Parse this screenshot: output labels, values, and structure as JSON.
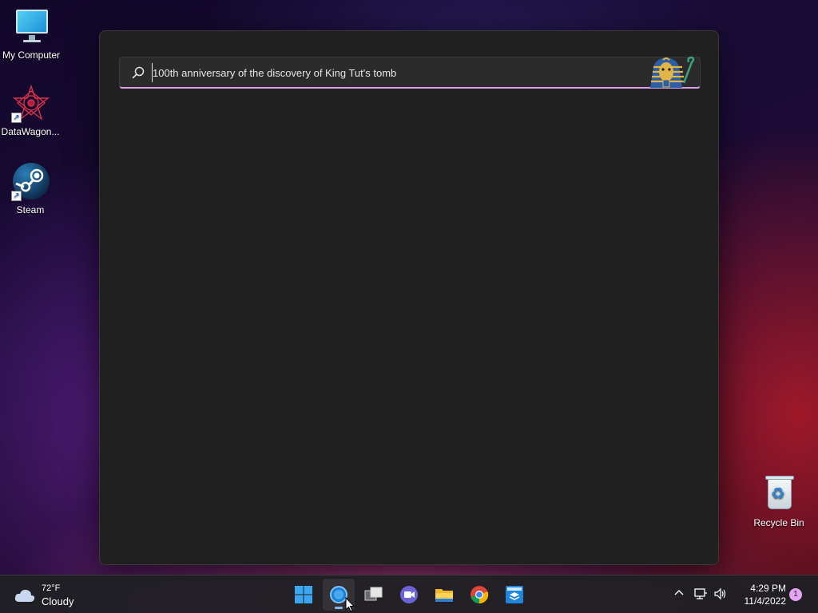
{
  "desktop": {
    "icons": [
      {
        "label": "My Computer",
        "icon": "computer-icon"
      },
      {
        "label": "DataWagon...",
        "icon": "datawagon-icon"
      },
      {
        "label": "Steam",
        "icon": "steam-icon"
      },
      {
        "label": "Recycle Bin",
        "icon": "recycle-bin-icon"
      }
    ]
  },
  "search": {
    "query": "100th anniversary of the discovery of King Tut's tomb",
    "icon": "search-icon",
    "highlight_icon": "tutankhamun-mask-icon",
    "accent_color": "#d9a0e8"
  },
  "taskbar": {
    "weather": {
      "temp": "72°F",
      "condition": "Cloudy",
      "icon": "cloud-icon"
    },
    "apps": [
      {
        "name": "Start",
        "icon": "windows-start-icon"
      },
      {
        "name": "Search",
        "icon": "search-app-icon",
        "active": true
      },
      {
        "name": "Task View",
        "icon": "task-view-icon"
      },
      {
        "name": "Teams Chat",
        "icon": "teams-chat-icon"
      },
      {
        "name": "File Explorer",
        "icon": "file-explorer-icon"
      },
      {
        "name": "Chrome",
        "icon": "chrome-icon"
      },
      {
        "name": "Store",
        "icon": "store-icon"
      }
    ],
    "tray": {
      "time": "4:29 PM",
      "date": "11/4/2022",
      "notifications": "1"
    }
  }
}
